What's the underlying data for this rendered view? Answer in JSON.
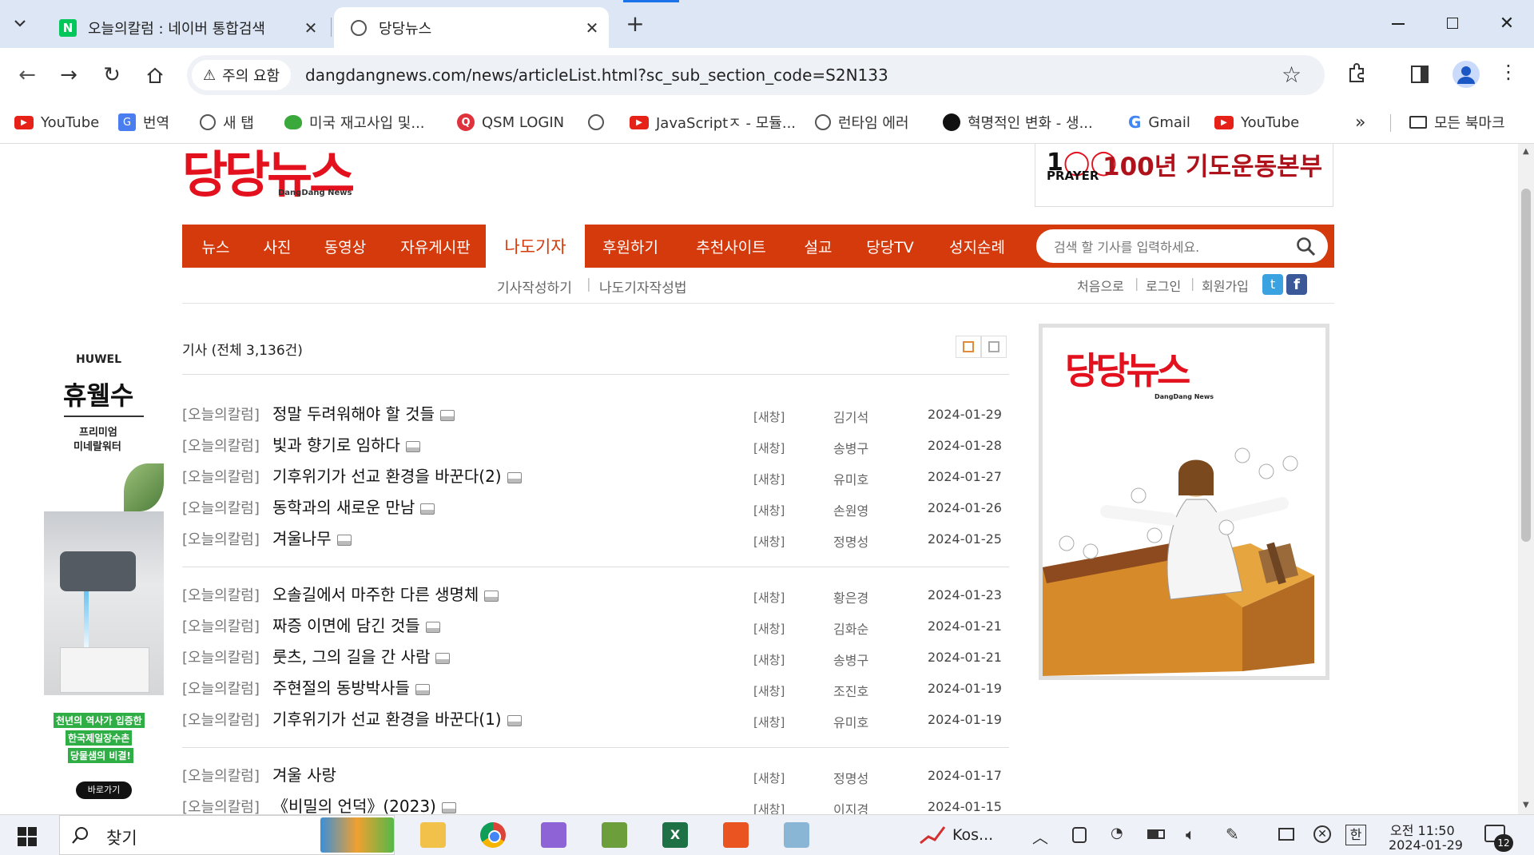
{
  "tabs": {
    "inactive": {
      "title": "오늘의칼럼 : 네이버 통합검색",
      "favicon": "N"
    },
    "active": {
      "title": "당당뉴스"
    }
  },
  "toolbar": {
    "security_chip": "주의 요함",
    "url": "dangdangnews.com/news/articleList.html?sc_sub_section_code=S2N133"
  },
  "bookmarks": [
    "YouTube",
    "번역",
    "새 탭",
    "미국 재고사입 및...",
    "QSM LOGIN",
    "JavaScriptㅈ - 모듈...",
    "런타임 에러",
    "혁명적인 변화 - 생...",
    "Gmail",
    "YouTube"
  ],
  "bookmarks_all": "모든 북마크",
  "site": {
    "logo_main": "당당뉴스",
    "logo_sub": "DangDang News",
    "banner_top": {
      "badge": "PRAYER",
      "text": "100년 기도운동본부"
    }
  },
  "gnb": [
    "뉴스",
    "사진",
    "동영상",
    "자유게시판",
    "나도기자",
    "후원하기",
    "추천사이트",
    "설교",
    "당당TV",
    "성지순례"
  ],
  "search": {
    "placeholder": "검색 할 기사를 입력하세요."
  },
  "submenu": {
    "write": "기사작성하기",
    "howto": "나도기자작성법"
  },
  "util": {
    "home": "처음으로",
    "login": "로그인",
    "join": "회원가입"
  },
  "article_count": "기사 (전체 3,136건)",
  "articles": [
    {
      "cat": "[오늘의칼럼]",
      "title": "정말 두려워해야 할 것들",
      "type": "[새창]",
      "author": "김기석",
      "date": "2024-01-29"
    },
    {
      "cat": "[오늘의칼럼]",
      "title": "빛과 향기로 임하다",
      "type": "[새창]",
      "author": "송병구",
      "date": "2024-01-28"
    },
    {
      "cat": "[오늘의칼럼]",
      "title": "기후위기가 선교 환경을 바꾼다(2)",
      "type": "[새창]",
      "author": "유미호",
      "date": "2024-01-27"
    },
    {
      "cat": "[오늘의칼럼]",
      "title": "동학과의 새로운 만남",
      "type": "[새창]",
      "author": "손원영",
      "date": "2024-01-26"
    },
    {
      "cat": "[오늘의칼럼]",
      "title": "겨울나무",
      "type": "[새창]",
      "author": "정명성",
      "date": "2024-01-25"
    },
    {
      "cat": "[오늘의칼럼]",
      "title": "오솔길에서 마주한 다른 생명체",
      "type": "[새창]",
      "author": "황은경",
      "date": "2024-01-23"
    },
    {
      "cat": "[오늘의칼럼]",
      "title": "짜증 이면에 담긴 것들",
      "type": "[새창]",
      "author": "김화순",
      "date": "2024-01-21"
    },
    {
      "cat": "[오늘의칼럼]",
      "title": "룻츠, 그의 길을 간 사람",
      "type": "[새창]",
      "author": "송병구",
      "date": "2024-01-21"
    },
    {
      "cat": "[오늘의칼럼]",
      "title": "주현절의 동방박사들",
      "type": "[새창]",
      "author": "조진호",
      "date": "2024-01-19"
    },
    {
      "cat": "[오늘의칼럼]",
      "title": "기후위기가 선교 환경을 바꾼다(1)",
      "type": "[새창]",
      "author": "유미호",
      "date": "2024-01-19"
    },
    {
      "cat": "[오늘의칼럼]",
      "title": "겨울 사랑",
      "type": "[새창]",
      "author": "정명성",
      "date": "2024-01-17"
    },
    {
      "cat": "[오늘의칼럼]",
      "title": "《비밀의 언덕》(2023)",
      "type": "[새창]",
      "author": "이지경",
      "date": "2024-01-15"
    }
  ],
  "left_ad": {
    "brand": "HUWEL",
    "product": "휴웰수",
    "line1": "프리미엄",
    "line2": "미네랄워터",
    "tag1": "천년의 역사가 입증한",
    "tag2": "한국제일장수촌",
    "tag3": "당물샘의 비결!",
    "cta": "바로가기"
  },
  "taskbar": {
    "search": "찾기",
    "kospi": "Kos...",
    "ime": "한",
    "time": "오전 11:50",
    "date": "2024-01-29",
    "notifications": "12"
  },
  "colors": {
    "brand_red": "#e3101d",
    "gnb": "#d53a0c",
    "tabbar": "#dce6f5"
  }
}
